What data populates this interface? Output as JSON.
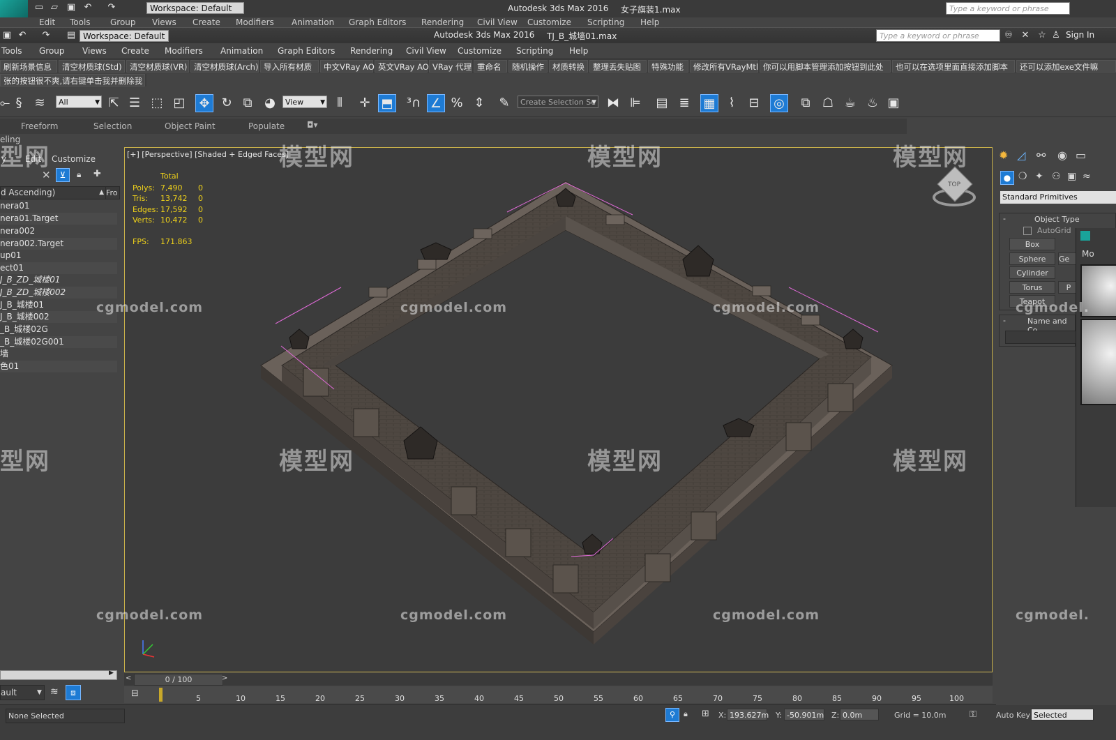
{
  "ghost_window": {
    "workspace": "Workspace: Default",
    "title": "Autodesk 3ds Max 2016",
    "file": "女子旗装1.max",
    "search_placeholder": "Type a keyword or phrase",
    "menu": [
      "Edit",
      "Tools",
      "Group",
      "Views",
      "Create",
      "Modifiers",
      "Animation",
      "Graph Editors",
      "Rendering",
      "Civil View",
      "Customize",
      "Scripting",
      "Help"
    ]
  },
  "titlebar": {
    "workspace": "Workspace: Default",
    "app_title": "Autodesk 3ds Max 2016",
    "file_name": "TJ_B_城墙01.max",
    "search_placeholder": "Type a keyword or phrase",
    "sign_in": "Sign In"
  },
  "menubar": [
    "Tools",
    "Group",
    "Views",
    "Create",
    "Modifiers",
    "Animation",
    "Graph Editors",
    "Rendering",
    "Civil View",
    "Customize",
    "Scripting",
    "Help"
  ],
  "scriptbar": {
    "buttons": [
      "刷新场景信息",
      "清空材质球(Std)",
      "清空材质球(VR)",
      "清空材质球(Arch)",
      "导入所有材质",
      "中文VRay AO",
      "英文VRay AO",
      "VRay 代理",
      "重命名",
      "随机操作",
      "材质转换",
      "整理丢失贴图",
      "特殊功能",
      "修改所有VRayMtl",
      "你可以用脚本管理添加按钮到此处",
      "也可以在选项里面直接添加脚本",
      "还可以添加exe文件嘛"
    ],
    "note": "张的按钮很不爽,请右键单击我并删除我"
  },
  "toolbar": {
    "filter_value": "All",
    "view_value": "View",
    "selection_set_placeholder": "Create Selection Se"
  },
  "ribbon": [
    "Freeform",
    "Selection",
    "Object Paint",
    "Populate"
  ],
  "explorer": {
    "header_partial": "eling",
    "tabs": [
      "y",
      "Edit",
      "Customize"
    ],
    "sort_label": "d Ascending)",
    "frozen_col": "Fro",
    "rows": [
      "nera01",
      "nera01.Target",
      "nera002",
      "nera002.Target",
      "up01",
      "ect01",
      "J_B_ZD_城楼01",
      "J_B_ZD_城楼002",
      "J_B_城楼01",
      "J_B_城楼002",
      "_B_城楼02G",
      "_B_城楼02G001",
      "墙",
      "色01"
    ],
    "layer_value": "ault"
  },
  "viewport": {
    "label": "[+] [Perspective] [Shaded + Edged Faces]",
    "stats_header": "Total",
    "stats": [
      {
        "label": "Polys:",
        "total": "7,490",
        "sel": "0"
      },
      {
        "label": "Tris:",
        "total": "13,742",
        "sel": "0"
      },
      {
        "label": "Edges:",
        "total": "17,592",
        "sel": "0"
      },
      {
        "label": "Verts:",
        "total": "10,472",
        "sel": "0"
      }
    ],
    "fps_label": "FPS:",
    "fps_value": "171.863",
    "viewcube_label": "TOP"
  },
  "timeline": {
    "frame": "0 / 100",
    "ticks": [
      "5",
      "10",
      "15",
      "20",
      "25",
      "30",
      "35",
      "40",
      "45",
      "50",
      "55",
      "60",
      "65",
      "70",
      "75",
      "80",
      "85",
      "90",
      "95",
      "100"
    ]
  },
  "statusbar": {
    "selection": "None Selected",
    "x_label": "X:",
    "x_value": "193.627m",
    "y_label": "Y:",
    "y_value": "-50.901m",
    "z_label": "Z:",
    "z_value": "0.0m",
    "grid": "Grid = 10.0m",
    "auto_key": "Auto Key",
    "selected": "Selected"
  },
  "cmdpanel": {
    "dropdown": "Standard Primitives",
    "object_type_title": "Object Type",
    "autogrid": "AutoGrid",
    "buttons": [
      "Box",
      "Sphere",
      "Cylinder",
      "Torus",
      "Teapot"
    ],
    "right_partials": [
      "",
      "Ge",
      "",
      "P",
      ""
    ],
    "name_color_title": "Name and Co",
    "far_right_partial": "Mo"
  },
  "watermarks": {
    "cgmodel": "cgmodel.com",
    "cgmodel_cut": "cgmodel.",
    "logo": "模型网",
    "logo_cut": "型网"
  },
  "colors": {
    "ui_bg": "#444444",
    "viewport_bg": "#3c3c3c",
    "viewport_border": "#c8b04a",
    "stats_yellow": "#f0d21a",
    "active_blue": "#1e7bd4",
    "wall_top": "#6b625c",
    "wall_face": "#4f4843",
    "selection_pink": "#e06ad8"
  },
  "icons": [
    "max-logo-icon",
    "new-file-icon",
    "open-icon",
    "save-icon",
    "undo-icon",
    "redo-icon",
    "select-icon",
    "move-icon",
    "rotate-icon",
    "scale-icon",
    "snap-icon",
    "mirror-icon",
    "align-icon",
    "layers-icon",
    "render-icon",
    "teapot-icon",
    "lock-icon",
    "key-icon"
  ]
}
